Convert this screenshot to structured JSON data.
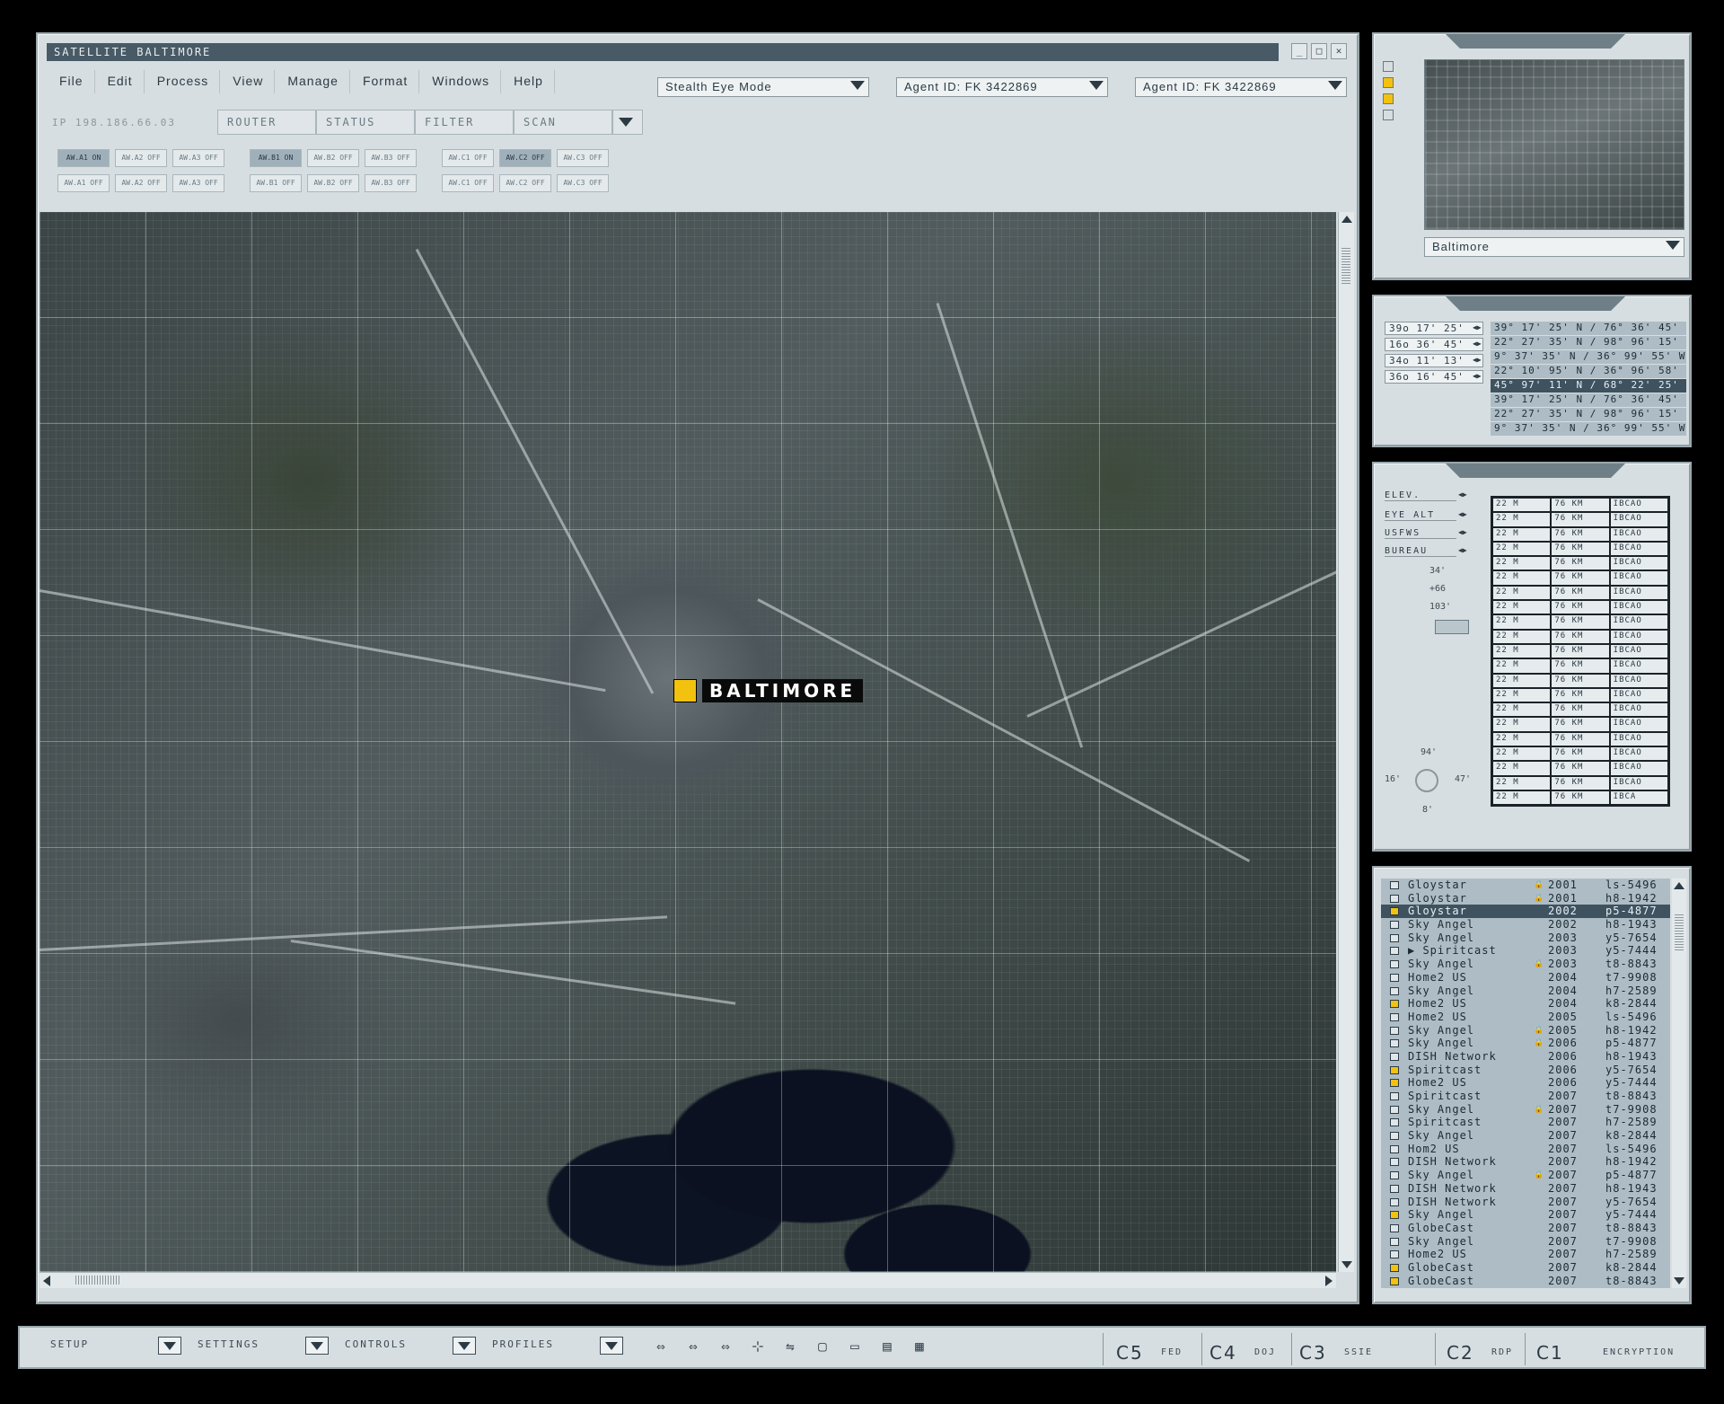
{
  "window": {
    "title": "SATELLITE BALTIMORE",
    "btn_min": "_",
    "btn_max": "□",
    "btn_close": "✕"
  },
  "menu": [
    "File",
    "Edit",
    "Process",
    "View",
    "Manage",
    "Format",
    "Windows",
    "Help"
  ],
  "dropdowns": {
    "mode": "Stealth Eye Mode",
    "agent1": "Agent ID: FK 3422869",
    "agent2": "Agent ID: FK 3422869"
  },
  "toolbar": {
    "ip": "IP 198.186.66.03",
    "router": "ROUTER",
    "status": "STATUS",
    "filter": "FILTER",
    "scan": "SCAN"
  },
  "aw_buttons": {
    "row1": [
      "AW.A1 ON",
      "AW.A2 OFF",
      "AW.A3 OFF",
      "AW.B1 ON",
      "AW.B2 OFF",
      "AW.B3 OFF",
      "AW.C1 OFF",
      "AW.C2 OFF",
      "AW.C3 OFF"
    ],
    "row2": [
      "AW.A1 OFF",
      "AW.A2 OFF",
      "AW.A3 OFF",
      "AW.B1 OFF",
      "AW.B2 OFF",
      "AW.B3 OFF",
      "AW.C1 OFF",
      "AW.C2 OFF",
      "AW.C3 OFF"
    ]
  },
  "map": {
    "city_label": "BALTIMORE",
    "marker_color": "#f2c20f"
  },
  "thumbnail": {
    "location": "Baltimore"
  },
  "coords": {
    "left": [
      "39o 17' 25'",
      "16o 36' 45'",
      "34o 11' 13'",
      "36o 16' 45'"
    ],
    "right": [
      "39° 17' 25' N / 76° 36' 45' W",
      "22° 27' 35' N / 98° 96' 15' W",
      "9° 37' 35' N / 36° 99' 55' W",
      "22° 10' 95' N / 36° 96' 58' W",
      "45° 97' 11' N / 68° 22' 25' W",
      "39° 17' 25' N / 76° 36' 45' W",
      "22° 27' 35' N / 98° 96' 15' W",
      "9° 37' 35' N / 36° 99' 55' W"
    ]
  },
  "elevation": {
    "labels": [
      "ELEV.",
      "EYE ALT",
      "USFWS",
      "BUREAU"
    ],
    "values": [
      "34'",
      "+66",
      "103'"
    ],
    "compass": {
      "n": "94'",
      "w": "16'",
      "e": "47'",
      "s": "8'"
    },
    "rows": [
      [
        "22 M",
        "76 KM",
        "IBCAO"
      ],
      [
        "22 M",
        "76 KM",
        "IBCAO"
      ],
      [
        "22 M",
        "76 KM",
        "IBCAO"
      ],
      [
        "22 M",
        "76 KM",
        "IBCAO"
      ],
      [
        "22 M",
        "76 KM",
        "IBCAO"
      ],
      [
        "22 M",
        "76 KM",
        "IBCAO"
      ],
      [
        "22 M",
        "76 KM",
        "IBCAO"
      ],
      [
        "22 M",
        "76 KM",
        "IBCAO"
      ],
      [
        "22 M",
        "76 KM",
        "IBCAO"
      ],
      [
        "22 M",
        "76 KM",
        "IBCAO"
      ],
      [
        "22 M",
        "76 KM",
        "IBCAO"
      ],
      [
        "22 M",
        "76 KM",
        "IBCAO"
      ],
      [
        "22 M",
        "76 KM",
        "IBCAO"
      ],
      [
        "22 M",
        "76 KM",
        "IBCAO"
      ],
      [
        "22 M",
        "76 KM",
        "IBCAO"
      ],
      [
        "22 M",
        "76 KM",
        "IBCAO"
      ],
      [
        "22 M",
        "76 KM",
        "IBCAO"
      ],
      [
        "22 M",
        "76 KM",
        "IBCAO"
      ],
      [
        "22 M",
        "76 KM",
        "IBCAO"
      ],
      [
        "22 M",
        "76 KM",
        "IBCAO"
      ],
      [
        "22 M",
        "76 KM",
        "IBCA"
      ]
    ]
  },
  "satellites": [
    {
      "name": "Gloystar",
      "lock": true,
      "year": "2001",
      "code": "ls-5496",
      "flag": ""
    },
    {
      "name": "Gloystar",
      "lock": true,
      "year": "2001",
      "code": "h8-1942",
      "flag": ""
    },
    {
      "name": "Gloystar",
      "lock": false,
      "year": "2002",
      "code": "p5-4877",
      "flag": "y",
      "selected": true
    },
    {
      "name": "Sky Angel",
      "lock": false,
      "year": "2002",
      "code": "h8-1943",
      "flag": ""
    },
    {
      "name": "Sky Angel",
      "lock": false,
      "year": "2003",
      "code": "y5-7654",
      "flag": ""
    },
    {
      "name": "▶ Spiritcast",
      "lock": false,
      "year": "2003",
      "code": "y5-7444",
      "flag": ""
    },
    {
      "name": "Sky Angel",
      "lock": true,
      "year": "2003",
      "code": "t8-8843",
      "flag": ""
    },
    {
      "name": "Home2 US",
      "lock": false,
      "year": "2004",
      "code": "t7-9908",
      "flag": ""
    },
    {
      "name": "Sky Angel",
      "lock": false,
      "year": "2004",
      "code": "h7-2589",
      "flag": ""
    },
    {
      "name": "Home2 US",
      "lock": false,
      "year": "2004",
      "code": "k8-2844",
      "flag": "y"
    },
    {
      "name": "Home2 US",
      "lock": false,
      "year": "2005",
      "code": "ls-5496",
      "flag": ""
    },
    {
      "name": "Sky Angel",
      "lock": true,
      "year": "2005",
      "code": "h8-1942",
      "flag": ""
    },
    {
      "name": "Sky Angel",
      "lock": true,
      "year": "2006",
      "code": "p5-4877",
      "flag": ""
    },
    {
      "name": "DISH Network",
      "lock": false,
      "year": "2006",
      "code": "h8-1943",
      "flag": ""
    },
    {
      "name": "Spiritcast",
      "lock": false,
      "year": "2006",
      "code": "y5-7654",
      "flag": "y"
    },
    {
      "name": "Home2 US",
      "lock": false,
      "year": "2006",
      "code": "y5-7444",
      "flag": "y"
    },
    {
      "name": "Spiritcast",
      "lock": false,
      "year": "2007",
      "code": "t8-8843",
      "flag": ""
    },
    {
      "name": "Sky Angel",
      "lock": true,
      "year": "2007",
      "code": "t7-9908",
      "flag": ""
    },
    {
      "name": "Spiritcast",
      "lock": false,
      "year": "2007",
      "code": "h7-2589",
      "flag": ""
    },
    {
      "name": "Sky Angel",
      "lock": false,
      "year": "2007",
      "code": "k8-2844",
      "flag": ""
    },
    {
      "name": "Hom2 US",
      "lock": false,
      "year": "2007",
      "code": "ls-5496",
      "flag": ""
    },
    {
      "name": "DISH Network",
      "lock": false,
      "year": "2007",
      "code": "h8-1942",
      "flag": ""
    },
    {
      "name": "Sky Angel",
      "lock": true,
      "year": "2007",
      "code": "p5-4877",
      "flag": ""
    },
    {
      "name": "DISH Network",
      "lock": false,
      "year": "2007",
      "code": "h8-1943",
      "flag": ""
    },
    {
      "name": "DISH Network",
      "lock": false,
      "year": "2007",
      "code": "y5-7654",
      "flag": ""
    },
    {
      "name": "Sky Angel",
      "lock": false,
      "year": "2007",
      "code": "y5-7444",
      "flag": "y"
    },
    {
      "name": "GlobeCast",
      "lock": false,
      "year": "2007",
      "code": "t8-8843",
      "flag": ""
    },
    {
      "name": "Sky Angel",
      "lock": false,
      "year": "2007",
      "code": "t7-9908",
      "flag": ""
    },
    {
      "name": "Home2 US",
      "lock": false,
      "year": "2007",
      "code": "h7-2589",
      "flag": ""
    },
    {
      "name": "GlobeCast",
      "lock": false,
      "year": "2007",
      "code": "k8-2844",
      "flag": "y"
    },
    {
      "name": "GlobeCast",
      "lock": false,
      "year": "2007",
      "code": "t8-8843",
      "flag": "y"
    }
  ],
  "bottom": {
    "setup": "SETUP",
    "settings": "SETTINGS",
    "controls": "CONTROLS",
    "profiles": "PROFILES",
    "icons": [
      "⇔",
      "⇔",
      "⇔",
      "⊹",
      "⇋",
      "▢",
      "▭",
      "▤",
      "▦"
    ],
    "channels": [
      {
        "num": "C5",
        "label": "FED"
      },
      {
        "num": "C4",
        "label": "DOJ"
      },
      {
        "num": "C3",
        "label": "SSIE"
      },
      {
        "num": "C2",
        "label": "RDP"
      },
      {
        "num": "C1",
        "label": "ENCRYPTION"
      }
    ]
  }
}
